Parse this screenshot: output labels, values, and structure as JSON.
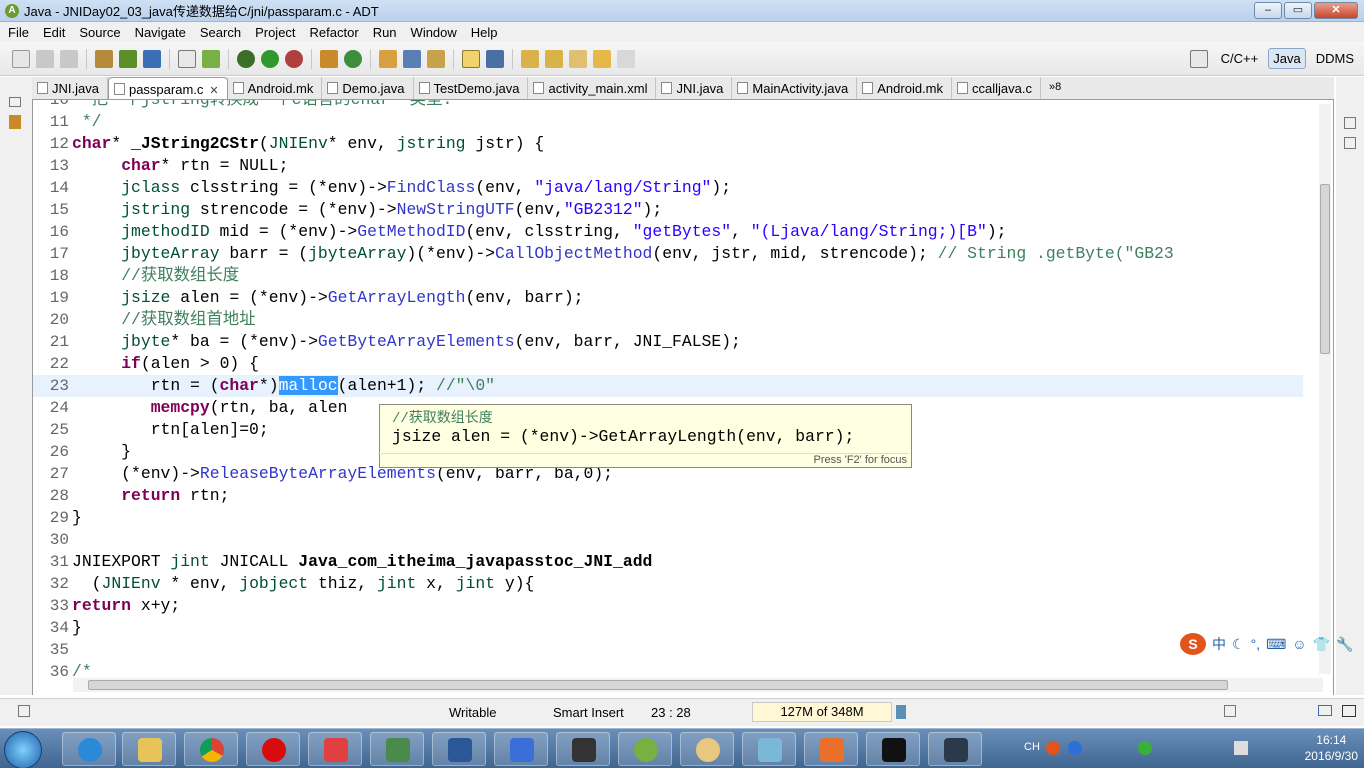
{
  "window": {
    "title": "Java - JNIDay02_03_java传递数据给C/jni/passparam.c - ADT",
    "app_icon": "adt-icon",
    "controls": [
      "minimize",
      "maximize",
      "close"
    ]
  },
  "menu": [
    "File",
    "Edit",
    "Source",
    "Navigate",
    "Search",
    "Project",
    "Refactor",
    "Run",
    "Window",
    "Help"
  ],
  "perspectives": [
    {
      "label": "C/C++",
      "active": false
    },
    {
      "label": "Java",
      "active": true
    },
    {
      "label": "DDMS",
      "active": false
    }
  ],
  "tabs": [
    {
      "label": "JNI.java",
      "active": false
    },
    {
      "label": "passparam.c",
      "active": true
    },
    {
      "label": "Android.mk",
      "active": false
    },
    {
      "label": "Demo.java",
      "active": false
    },
    {
      "label": "TestDemo.java",
      "active": false
    },
    {
      "label": "activity_main.xml",
      "active": false
    },
    {
      "label": "JNI.java",
      "active": false
    },
    {
      "label": "MainActivity.java",
      "active": false
    },
    {
      "label": "Android.mk",
      "active": false
    },
    {
      "label": "ccalljava.c",
      "active": false
    },
    {
      "label": "8",
      "active": false
    }
  ],
  "editor": {
    "lines": [
      {
        "n": "10",
        "segs": [
          {
            "t": "  把一个jstring转换成一个c语言的char* 类型.",
            "c": "cm"
          }
        ]
      },
      {
        "n": "11",
        "segs": [
          {
            "t": " */",
            "c": "cm"
          }
        ]
      },
      {
        "n": "12",
        "segs": [
          {
            "t": "char",
            "c": "kw"
          },
          {
            "t": "* ",
            "c": ""
          },
          {
            "t": "_JString2CStr",
            "c": "bd"
          },
          {
            "t": "(",
            "c": ""
          },
          {
            "t": "JNIEnv",
            "c": "ty"
          },
          {
            "t": "* env, ",
            "c": ""
          },
          {
            "t": "jstring",
            "c": "ty"
          },
          {
            "t": " jstr) {",
            "c": ""
          }
        ]
      },
      {
        "n": "13",
        "segs": [
          {
            "t": "     ",
            "c": ""
          },
          {
            "t": "char",
            "c": "kw"
          },
          {
            "t": "* rtn = NULL;",
            "c": ""
          }
        ]
      },
      {
        "n": "14",
        "segs": [
          {
            "t": "     ",
            "c": ""
          },
          {
            "t": "jclass",
            "c": "ty"
          },
          {
            "t": " clsstring = (*env)->",
            "c": ""
          },
          {
            "t": "FindClass",
            "c": "fn"
          },
          {
            "t": "(env, ",
            "c": ""
          },
          {
            "t": "\"java/lang/String\"",
            "c": "st"
          },
          {
            "t": ");",
            "c": ""
          }
        ]
      },
      {
        "n": "15",
        "segs": [
          {
            "t": "     ",
            "c": ""
          },
          {
            "t": "jstring",
            "c": "ty"
          },
          {
            "t": " strencode = (*env)->",
            "c": ""
          },
          {
            "t": "NewStringUTF",
            "c": "fn"
          },
          {
            "t": "(env,",
            "c": ""
          },
          {
            "t": "\"GB2312\"",
            "c": "st"
          },
          {
            "t": ");",
            "c": ""
          }
        ]
      },
      {
        "n": "16",
        "segs": [
          {
            "t": "     ",
            "c": ""
          },
          {
            "t": "jmethodID",
            "c": "ty"
          },
          {
            "t": " mid = (*env)->",
            "c": ""
          },
          {
            "t": "GetMethodID",
            "c": "fn"
          },
          {
            "t": "(env, clsstring, ",
            "c": ""
          },
          {
            "t": "\"getBytes\"",
            "c": "st"
          },
          {
            "t": ", ",
            "c": ""
          },
          {
            "t": "\"(Ljava/lang/String;)[B\"",
            "c": "st"
          },
          {
            "t": ");",
            "c": ""
          }
        ]
      },
      {
        "n": "17",
        "segs": [
          {
            "t": "     ",
            "c": ""
          },
          {
            "t": "jbyteArray",
            "c": "ty"
          },
          {
            "t": " barr = (",
            "c": ""
          },
          {
            "t": "jbyteArray",
            "c": "ty"
          },
          {
            "t": ")(*env)->",
            "c": ""
          },
          {
            "t": "CallObjectMethod",
            "c": "fn"
          },
          {
            "t": "(env, jstr, mid, strencode); ",
            "c": ""
          },
          {
            "t": "// String .getByte(\"GB23",
            "c": "cm"
          }
        ]
      },
      {
        "n": "18",
        "segs": [
          {
            "t": "     ",
            "c": ""
          },
          {
            "t": "//获取数组长度",
            "c": "cm"
          }
        ]
      },
      {
        "n": "19",
        "segs": [
          {
            "t": "     ",
            "c": ""
          },
          {
            "t": "jsize",
            "c": "ty"
          },
          {
            "t": " alen = (*env)->",
            "c": ""
          },
          {
            "t": "GetArrayLength",
            "c": "fn"
          },
          {
            "t": "(env, barr);",
            "c": ""
          }
        ]
      },
      {
        "n": "20",
        "segs": [
          {
            "t": "     ",
            "c": ""
          },
          {
            "t": "//获取数组首地址",
            "c": "cm"
          }
        ]
      },
      {
        "n": "21",
        "segs": [
          {
            "t": "     ",
            "c": ""
          },
          {
            "t": "jbyte",
            "c": "ty"
          },
          {
            "t": "* ba = (*env)->",
            "c": ""
          },
          {
            "t": "GetByteArrayElements",
            "c": "fn"
          },
          {
            "t": "(env, barr, JNI_FALSE);",
            "c": ""
          }
        ]
      },
      {
        "n": "22",
        "segs": [
          {
            "t": "     ",
            "c": ""
          },
          {
            "t": "if",
            "c": "kw"
          },
          {
            "t": "(alen > 0) {",
            "c": ""
          }
        ]
      },
      {
        "n": "23",
        "current": true,
        "segs": [
          {
            "t": "        rtn = (",
            "c": ""
          },
          {
            "t": "char",
            "c": "kw"
          },
          {
            "t": "*)",
            "c": ""
          },
          {
            "t": "malloc",
            "c": "hl"
          },
          {
            "t": "(alen+1); ",
            "c": ""
          },
          {
            "t": "//\"\\0\"",
            "c": "cm"
          }
        ]
      },
      {
        "n": "24",
        "segs": [
          {
            "t": "        ",
            "c": ""
          },
          {
            "t": "memcpy",
            "c": "kw"
          },
          {
            "t": "(rtn, ba, alen",
            "c": ""
          }
        ]
      },
      {
        "n": "25",
        "segs": [
          {
            "t": "        rtn[alen]=0;",
            "c": ""
          }
        ]
      },
      {
        "n": "26",
        "segs": [
          {
            "t": "     }",
            "c": ""
          }
        ]
      },
      {
        "n": "27",
        "segs": [
          {
            "t": "     (*env)->",
            "c": ""
          },
          {
            "t": "ReleaseByteArrayElements",
            "c": "fn"
          },
          {
            "t": "(env, barr, ba,0);",
            "c": ""
          }
        ]
      },
      {
        "n": "28",
        "segs": [
          {
            "t": "     ",
            "c": ""
          },
          {
            "t": "return",
            "c": "kw"
          },
          {
            "t": " rtn;",
            "c": ""
          }
        ]
      },
      {
        "n": "29",
        "segs": [
          {
            "t": "}",
            "c": ""
          }
        ]
      },
      {
        "n": "30",
        "segs": [
          {
            "t": "",
            "c": ""
          }
        ]
      },
      {
        "n": "31",
        "segs": [
          {
            "t": "JNIEXPORT ",
            "c": ""
          },
          {
            "t": "jint",
            "c": "ty"
          },
          {
            "t": " JNICALL ",
            "c": ""
          },
          {
            "t": "Java_com_itheima_javapasstoc_JNI_add",
            "c": "bd"
          }
        ]
      },
      {
        "n": "32",
        "segs": [
          {
            "t": "  (",
            "c": ""
          },
          {
            "t": "JNIEnv",
            "c": "ty"
          },
          {
            "t": " * env, ",
            "c": ""
          },
          {
            "t": "jobject",
            "c": "ty"
          },
          {
            "t": " thiz, ",
            "c": ""
          },
          {
            "t": "jint",
            "c": "ty"
          },
          {
            "t": " x, ",
            "c": ""
          },
          {
            "t": "jint",
            "c": "ty"
          },
          {
            "t": " y){",
            "c": ""
          }
        ]
      },
      {
        "n": "33",
        "segs": [
          {
            "t": "return",
            "c": "kw"
          },
          {
            "t": " x+y;",
            "c": ""
          }
        ]
      },
      {
        "n": "34",
        "segs": [
          {
            "t": "}",
            "c": ""
          }
        ]
      },
      {
        "n": "35",
        "segs": [
          {
            "t": "",
            "c": ""
          }
        ]
      },
      {
        "n": "36",
        "segs": [
          {
            "t": "/*",
            "c": "cm"
          }
        ]
      }
    ],
    "hover": {
      "comment": "//获取数组长度",
      "code": "jsize alen = (*env)->GetArrayLength(env, barr);",
      "footer": "Press 'F2' for focus"
    }
  },
  "status": {
    "writable": "Writable",
    "insert_mode": "Smart Insert",
    "position": "23 : 28",
    "heap": "127M of 348M"
  },
  "ime": {
    "logo": "S",
    "lang": "中"
  },
  "tray": {
    "lang": "CH",
    "time": "16:14",
    "date": "2016/9/30"
  },
  "taskbar_apps": [
    "start-orb",
    "ie-icon",
    "explorer-icon",
    "chrome-icon",
    "opera-icon",
    "paint-icon",
    "monitor-icon",
    "word-icon",
    "devcpp-icon",
    "android-icon",
    "brackets-icon",
    "palette-icon",
    "notepad-icon",
    "slides-icon",
    "cmd-icon",
    "nox-icon"
  ]
}
